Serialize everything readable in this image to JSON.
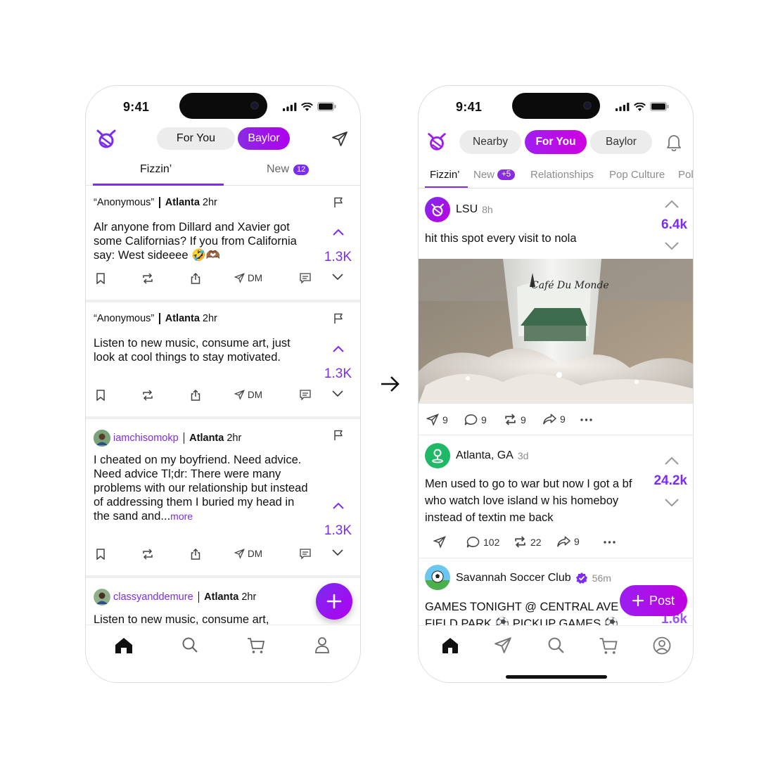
{
  "left": {
    "time": "9:41",
    "header_tabs": [
      {
        "label": "For You"
      },
      {
        "label": "Baylor"
      }
    ],
    "sub_tabs": [
      {
        "label": "Fizzin’"
      },
      {
        "label": "New",
        "badge": "12"
      }
    ],
    "posts": [
      {
        "author": "“Anonymous”",
        "location": "Atlanta",
        "time": "2hr",
        "text": "Alr anyone from Dillard and Xavier got some Californias? If you from California say: West sideeee 🤣🫶🏾",
        "votes": "1.3K",
        "dm": "DM"
      },
      {
        "author": "“Anonymous”",
        "location": "Atlanta",
        "time": "2hr",
        "text": "Listen to new music, consume art, just look at cool things to stay motivated.",
        "votes": "1.3K",
        "dm": "DM"
      },
      {
        "author": "iamchisomokp",
        "location": "Atlanta",
        "time": "2hr",
        "text": "I cheated on my boyfriend. Need advice. Need advice Tl;dr: There were many problems with our relationship but instead of addressing them I buried my head in the sand and...",
        "more": "more",
        "votes": "1.3K",
        "dm": "DM"
      },
      {
        "author": "classyanddemure",
        "location": "Atlanta",
        "time": "2hr",
        "text": "Listen to new music, consume art,"
      }
    ]
  },
  "right": {
    "time": "9:41",
    "header_tabs": [
      {
        "label": "Nearby"
      },
      {
        "label": "For You"
      },
      {
        "label": "Baylor"
      }
    ],
    "sub_tabs": [
      {
        "label": "Fizzin’"
      },
      {
        "label": "New",
        "badge": "+5"
      },
      {
        "label": "Relationships"
      },
      {
        "label": "Pop Culture"
      },
      {
        "label": "Pol"
      }
    ],
    "posts": [
      {
        "author": "LSU",
        "time": "8h",
        "text": "hit this spot every visit to nola",
        "votes": "6.4k",
        "image_caption": "Café Du Monde",
        "dm": "9",
        "comments": "9",
        "reposts": "9",
        "shares": "9"
      },
      {
        "author": "Atlanta, GA",
        "time": "3d",
        "text": "Men used to go to war but now I got a bf who watch love island w his homeboy instead of textin me back",
        "votes": "24.2k",
        "comments": "102",
        "reposts": "22",
        "shares": "9"
      },
      {
        "author": "Savannah Soccer Club",
        "time": "56m",
        "text": "GAMES TONIGHT @ CENTRAL AVE FIELD PARK ⚽ PICKUP GAMES ⚽",
        "votes": "1.6k"
      }
    ],
    "post_button": "Post"
  },
  "colors": {
    "accent": "#7b2cf0",
    "accent_magenta": "#b000f0",
    "location_green": "#1fb866"
  }
}
